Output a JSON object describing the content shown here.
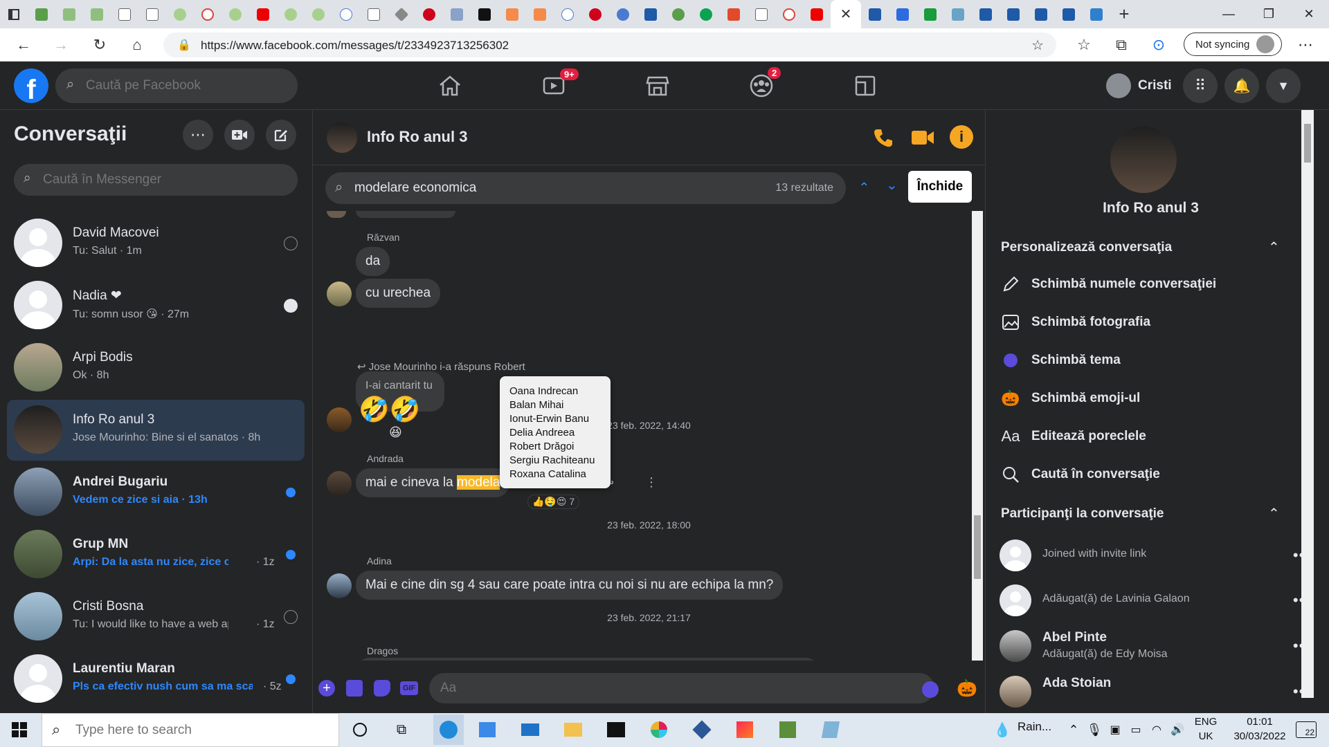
{
  "browser": {
    "url": "https://www.facebook.com/messages/t/2334923713256302",
    "sync_label": "Not syncing"
  },
  "fb": {
    "search_placeholder": "Caută pe Facebook",
    "watch_badge": "9+",
    "groups_badge": "2",
    "user_name": "Cristi"
  },
  "sidebar": {
    "title": "Conversaţii",
    "search_placeholder": "Caută în Messenger",
    "conversations": [
      {
        "name": "David Macovei",
        "preview": "Tu: Salut · 1m"
      },
      {
        "name": "Nadia ❤",
        "preview": "Tu: somn usor 😘 · 27m"
      },
      {
        "name": "Arpi Bodis",
        "preview": "Ok · 8h"
      },
      {
        "name": "Info Ro anul 3",
        "preview": "Jose Mourinho: Bine si el sanatos · 8h"
      },
      {
        "name": "Andrei Bugariu",
        "preview": "Vedem ce zice si aia · 13h"
      },
      {
        "name": "Grup MN",
        "preview": "Arpi: Da la asta nu zice, zice ca si ...",
        "time": "· 1z"
      },
      {
        "name": "Cristi Bosna",
        "preview": "Tu: I would like to have a web appl...",
        "time": "· 1z"
      },
      {
        "name": "Laurentiu Maran",
        "preview": "Pls ca efectiv nush cum sa ma sca...",
        "time": "· 5z"
      }
    ]
  },
  "chat": {
    "title": "Info Ro anul 3",
    "search_query": "modelare economica",
    "search_count": "13 rezultate",
    "close_label": "Închide",
    "messages": {
      "razvan_sender": "Răzvan",
      "m1": "da",
      "m2": "cu urechea",
      "reply_note": "Jose Mourinho i-a răspuns Robert",
      "m3": "I-ai cantarit tu",
      "m4_emoji": "🤣🤣",
      "ts1": "23 feb. 2022, 14:40",
      "andrada_sender": "Andrada",
      "m5_prefix": "mai e cineva la ",
      "m5_highlight": "modela",
      "reaction_count": "7",
      "ts2": "23 feb. 2022, 18:00",
      "adina_sender": "Adina",
      "m6": "Mai e cine din sg 4 sau care poate intra cu noi si nu are echipa la mn?",
      "ts3": "23 feb. 2022, 21:17",
      "dragos_sender": "Dragos"
    },
    "tooltip_names": [
      "Oana Indrecan",
      "Balan Mihai",
      "Ionut-Erwin Banu",
      "Delia Andreea",
      "Robert Drăgoi",
      "Sergiu Rachiteanu",
      "Roxana Catalina"
    ],
    "composer_placeholder": "Aa"
  },
  "info": {
    "title": "Info Ro anul 3",
    "customize_title": "Personalizează conversaţia",
    "options": [
      "Schimbă numele conversaţiei",
      "Schimbă fotografia",
      "Schimbă tema",
      "Schimbă emoji-ul",
      "Editează poreclele",
      "Caută în conversaţie"
    ],
    "participants_title": "Participanţi la conversaţie",
    "participants": [
      {
        "name": "",
        "sub": "Joined with invite link"
      },
      {
        "name": "",
        "sub": "Adăugat(ă) de Lavinia Galaon"
      },
      {
        "name": "Abel Pinte",
        "sub": "Adăugat(ă) de Edy Moisa"
      },
      {
        "name": "Ada Stoian",
        "sub": ""
      }
    ]
  },
  "taskbar": {
    "search_placeholder": "Type here to search",
    "weather": "Rain...",
    "lang1": "ENG",
    "lang2": "UK",
    "time": "01:01",
    "date": "30/03/2022",
    "notif_count": "22"
  },
  "colors": {
    "accent": "#1877f2",
    "orange": "#f5a623",
    "highlight": "#f7b928"
  }
}
